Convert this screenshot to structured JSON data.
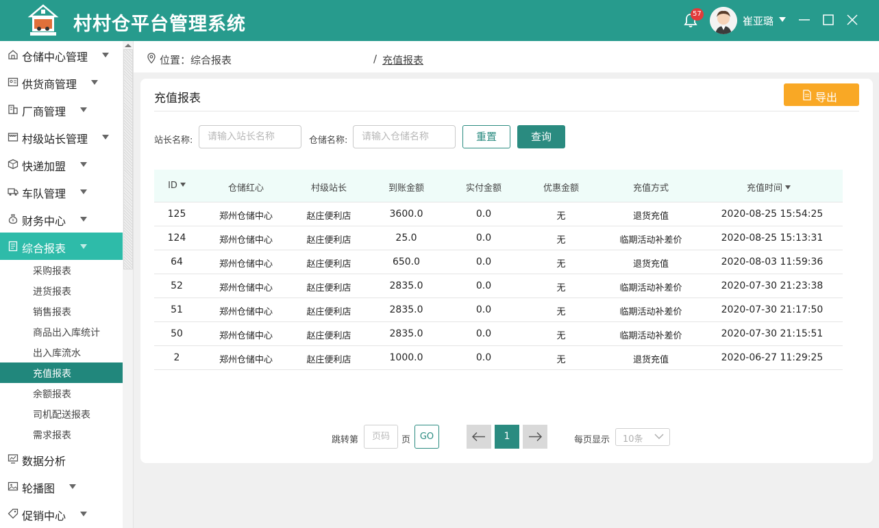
{
  "header": {
    "app_title": "村村仓平台管理系统",
    "notification_count": "57",
    "username": "崔亚璐"
  },
  "sidebar": {
    "items": [
      {
        "label": "仓储中心管理",
        "icon": "warehouse-icon",
        "has_caret": true
      },
      {
        "label": "供货商管理",
        "icon": "supplier-icon",
        "has_caret": true
      },
      {
        "label": "厂商管理",
        "icon": "building-icon",
        "has_caret": true
      },
      {
        "label": "村级站长管理",
        "icon": "store-icon",
        "has_caret": true
      },
      {
        "label": "快递加盟",
        "icon": "package-icon",
        "has_caret": true
      },
      {
        "label": "车队管理",
        "icon": "truck-icon",
        "has_caret": true
      },
      {
        "label": "财务中心",
        "icon": "money-bag-icon",
        "has_caret": true
      },
      {
        "label": "综合报表",
        "icon": "report-icon",
        "has_caret": true,
        "active": true
      },
      {
        "label": "数据分析",
        "icon": "monitor-chart-icon",
        "has_caret": false
      },
      {
        "label": "轮播图",
        "icon": "image-icon",
        "has_caret": true
      },
      {
        "label": "促销中心",
        "icon": "tag-icon",
        "has_caret": true
      }
    ],
    "sub_items": [
      {
        "label": "采购报表"
      },
      {
        "label": "进货报表"
      },
      {
        "label": "销售报表"
      },
      {
        "label": "商品出入库统计"
      },
      {
        "label": "出入库流水"
      },
      {
        "label": "充值报表",
        "active": true
      },
      {
        "label": "余额报表"
      },
      {
        "label": "司机配送报表"
      },
      {
        "label": "需求报表"
      }
    ]
  },
  "breadcrumb": {
    "prefix": "位置：综合报表",
    "separator": "/",
    "current": "充值报表"
  },
  "card": {
    "title": "充值报表",
    "export_label": "导出"
  },
  "filters": {
    "station_label": "站长名称:",
    "station_placeholder": "请输入站长名称",
    "warehouse_label": "仓储名称:",
    "warehouse_placeholder": "请输入仓储名称",
    "reset_label": "重置",
    "query_label": "查询"
  },
  "table": {
    "columns": [
      "ID",
      "仓储红心",
      "村级站长",
      "到账金额",
      "实付金额",
      "优惠金额",
      "充值方式",
      "充值时间"
    ],
    "rows": [
      [
        "125",
        "郑州仓储中心",
        "赵庄便利店",
        "3600.0",
        "0.0",
        "无",
        "退货充值",
        "2020-08-25 15:54:25"
      ],
      [
        "124",
        "郑州仓储中心",
        "赵庄便利店",
        "25.0",
        "0.0",
        "无",
        "临期活动补差价",
        "2020-08-25 15:13:31"
      ],
      [
        "64",
        "郑州仓储中心",
        "赵庄便利店",
        "650.0",
        "0.0",
        "无",
        "退货充值",
        "2020-08-03 11:59:36"
      ],
      [
        "52",
        "郑州仓储中心",
        "赵庄便利店",
        "2835.0",
        "0.0",
        "无",
        "临期活动补差价",
        "2020-07-30 21:23:38"
      ],
      [
        "51",
        "郑州仓储中心",
        "赵庄便利店",
        "2835.0",
        "0.0",
        "无",
        "临期活动补差价",
        "2020-07-30 21:17:50"
      ],
      [
        "50",
        "郑州仓储中心",
        "赵庄便利店",
        "2835.0",
        "0.0",
        "无",
        "临期活动补差价",
        "2020-07-30 21:15:51"
      ],
      [
        "2",
        "郑州仓储中心",
        "赵庄便利店",
        "1000.0",
        "0.0",
        "无",
        "退货充值",
        "2020-06-27 11:29:25"
      ]
    ]
  },
  "pagination": {
    "jump_label": "跳转第",
    "page_placeholder": "页码",
    "page_unit": "页",
    "go_label": "GO",
    "current_page": "1",
    "page_size_label": "每页显示",
    "page_size_value": "10条"
  },
  "colors": {
    "header_bg": "#279b8d",
    "active_menu": "#2ebba9",
    "active_sub": "#21877c",
    "primary_button": "#2a8b80",
    "export_button": "#f9a825",
    "table_header_bg": "#effcf9",
    "badge": "#e23b3b"
  }
}
